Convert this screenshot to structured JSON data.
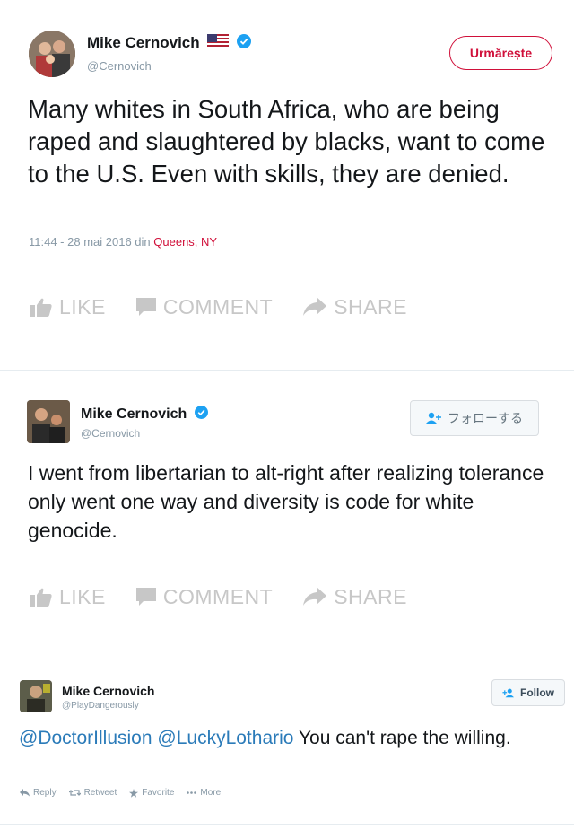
{
  "tweet1": {
    "name": "Mike Cernovich",
    "handle": "@Cernovich",
    "follow_label": "Urmărește",
    "text": "Many whites in South Africa, who are being raped and slaughtered by blacks, want to come to the U.S. Even with skills, they are denied.",
    "timestamp": "11:44 - 28 mai 2016 din",
    "location": "Queens, NY"
  },
  "tweet2": {
    "name": "Mike Cernovich",
    "handle": "@Cernovich",
    "follow_label": "フォローする",
    "text": "I went from libertarian to alt-right after realizing tolerance only went one way and diversity is code for white genocide."
  },
  "tweet3": {
    "name": "Mike Cernovich",
    "handle": "@PlayDangerously",
    "follow_label": "Follow",
    "mention1": "@DoctorIllusion",
    "mention2": "@LuckyLothario",
    "text": "You can't rape the willing.",
    "actions": {
      "reply": "Reply",
      "retweet": "Retweet",
      "favorite": "Favorite",
      "more": "More"
    }
  },
  "fb_actions": {
    "like": "LIKE",
    "comment": "COMMENT",
    "share": "SHARE"
  },
  "colors": {
    "verified": "#1da1f2",
    "accent_red": "#d0103a",
    "link": "#2b7bb9",
    "action_gray": "#c7c7c7"
  }
}
